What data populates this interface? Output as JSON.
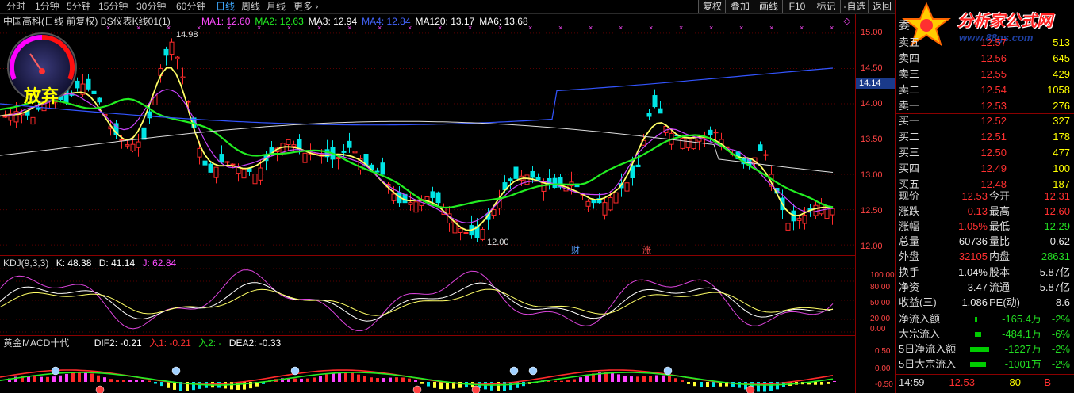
{
  "toolbar": {
    "periods": [
      "分时",
      "1分钟",
      "5分钟",
      "15分钟",
      "30分钟",
      "60分钟",
      "日线",
      "周线",
      "月线",
      "更多 ›"
    ],
    "active_period": "日线",
    "buttons": [
      "复权",
      "叠加",
      "画线",
      "F10",
      "标记",
      "-自选",
      "返回"
    ]
  },
  "main": {
    "title": "中国高科(日线 前复权) BS仪表K线01(1)",
    "ma": [
      {
        "label": "MA1: 12.60",
        "color": "#ff4cff"
      },
      {
        "label": "MA2: 12.63",
        "color": "#22ee22"
      },
      {
        "label": "MA3: 12.94",
        "color": "#ffffff"
      },
      {
        "label": "MA4: 12.84",
        "color": "#4466ff"
      },
      {
        "label": "MA120: 13.17",
        "color": "#ffffff"
      },
      {
        "label": "MA6: 13.68",
        "color": "#ffffff"
      }
    ],
    "high_label": "14.98",
    "low_label": "12.00",
    "gauge_text": "放弃",
    "markers": [
      "财",
      "涨"
    ]
  },
  "axis": {
    "labels": [
      "15.00",
      "14.50",
      "14.00",
      "13.50",
      "13.00",
      "12.50",
      "12.00"
    ],
    "current": "14.14",
    "kdj_labels": [
      "100.00",
      "80.00",
      "50.00",
      "20.00",
      "0.00"
    ],
    "macd_labels": [
      "0.50",
      "0.00",
      "-0.50"
    ]
  },
  "kdj": {
    "title": "KDJ(9,3,3)",
    "k": "K: 48.38",
    "d": "D: 41.14",
    "j": "J: 62.84"
  },
  "macd": {
    "title": "黄金MACD十代",
    "dif": "DIF2: -0.21",
    "in1": "入1: -0.21",
    "in2": "入2: -",
    "dea": "DEA2: -0.33"
  },
  "quote": {
    "logo": "分析家公式网",
    "logo_url": "www.88gs.com",
    "wei": "委",
    "sell": [
      {
        "label": "卖五",
        "price": "12.57",
        "vol": "513"
      },
      {
        "label": "卖四",
        "price": "12.56",
        "vol": "645"
      },
      {
        "label": "卖三",
        "price": "12.55",
        "vol": "429"
      },
      {
        "label": "卖二",
        "price": "12.54",
        "vol": "1058"
      },
      {
        "label": "卖一",
        "price": "12.53",
        "vol": "276"
      }
    ],
    "buy": [
      {
        "label": "买一",
        "price": "12.52",
        "vol": "327"
      },
      {
        "label": "买二",
        "price": "12.51",
        "vol": "178"
      },
      {
        "label": "买三",
        "price": "12.50",
        "vol": "477"
      },
      {
        "label": "买四",
        "price": "12.49",
        "vol": "100"
      },
      {
        "label": "买五",
        "price": "12.48",
        "vol": "187"
      }
    ],
    "stats": [
      {
        "l1": "现价",
        "v1": "12.53",
        "c1": "red",
        "l2": "今开",
        "v2": "12.31",
        "c2": "red"
      },
      {
        "l1": "涨跌",
        "v1": "0.13",
        "c1": "red",
        "l2": "最高",
        "v2": "12.60",
        "c2": "red"
      },
      {
        "l1": "涨幅",
        "v1": "1.05%",
        "c1": "red",
        "l2": "最低",
        "v2": "12.29",
        "c2": "green"
      },
      {
        "l1": "总量",
        "v1": "60736",
        "c1": "white",
        "l2": "量比",
        "v2": "0.62",
        "c2": "white"
      },
      {
        "l1": "外盘",
        "v1": "32105",
        "c1": "red",
        "l2": "内盘",
        "v2": "28631",
        "c2": "green"
      }
    ],
    "finance": [
      {
        "l1": "换手",
        "v1": "1.04%",
        "l2": "股本",
        "v2": "5.87亿"
      },
      {
        "l1": "净资",
        "v1": "3.47",
        "l2": "流通",
        "v2": "5.87亿"
      },
      {
        "l1": "收益(三)",
        "v1": "1.086",
        "l2": "PE(动)",
        "v2": "8.6"
      }
    ],
    "flows": [
      {
        "label": "净流入额",
        "value": "-165.4万",
        "pct": "-2%",
        "bar": 3
      },
      {
        "label": "大宗流入",
        "value": "-484.1万",
        "pct": "-6%",
        "bar": 8
      },
      {
        "label": "5日净流入额",
        "value": "-1227万",
        "pct": "-2%",
        "bar": 24
      },
      {
        "label": "5日大宗流入",
        "value": "-1001万",
        "pct": "-2%",
        "bar": 20
      }
    ],
    "tick": {
      "time": "14:59",
      "price": "12.53",
      "vol": "80",
      "side": "B"
    }
  }
}
